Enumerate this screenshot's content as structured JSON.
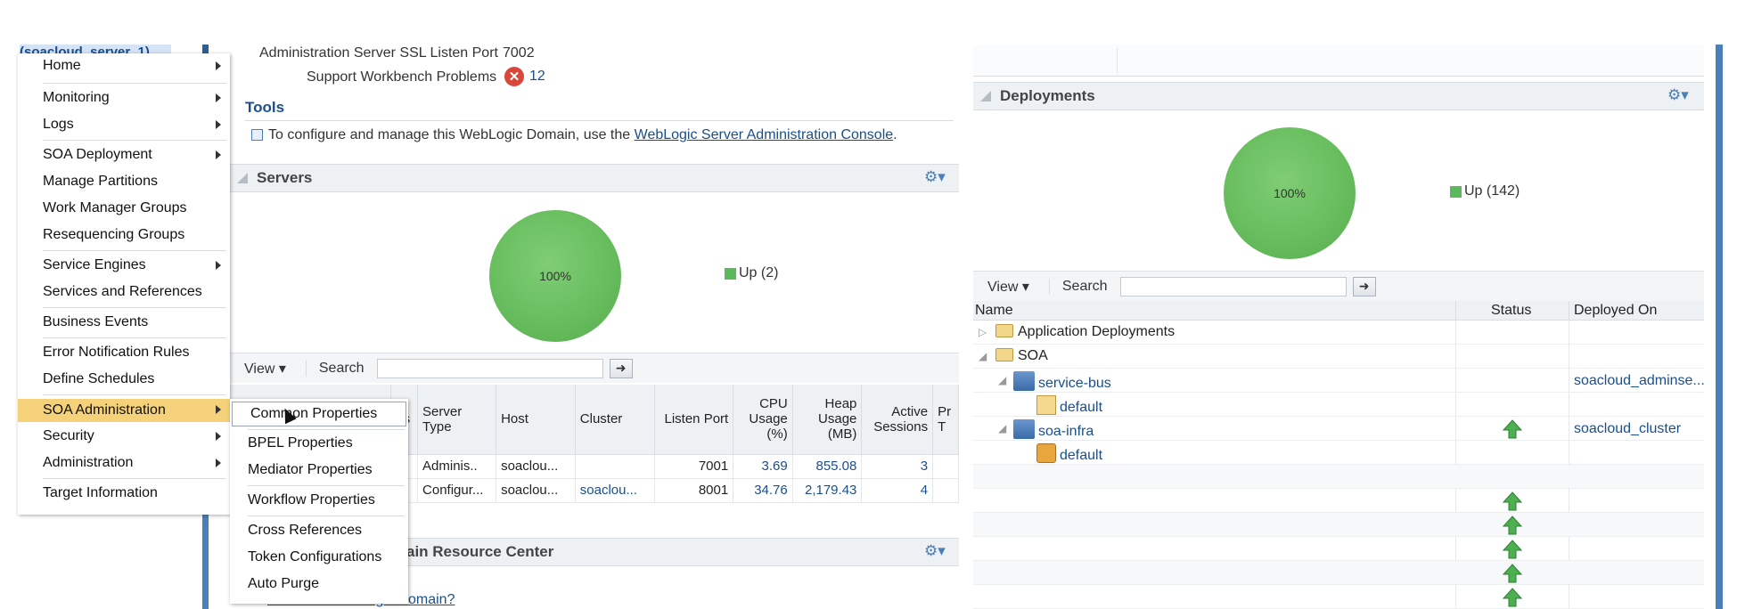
{
  "left_nav": {
    "selected_node": "(soacloud_server_1)"
  },
  "general": {
    "ssl_port_label": "Administration Server SSL Listen Port",
    "ssl_port_value": "7002",
    "workbench_label": "Support Workbench Problems",
    "workbench_count": "12"
  },
  "tools": {
    "title": "Tools",
    "text_before": "To configure and manage this WebLogic Domain, use the",
    "link": "WebLogic Server Administration Console",
    "text_after": "."
  },
  "servers": {
    "title": "Servers",
    "pie_label": "100%",
    "legend": "Up (2)",
    "view_label": "View",
    "search_label": "Search",
    "columns": [
      "us",
      "Server Type",
      "Host",
      "Cluster",
      "Listen Port",
      "CPU Usage (%)",
      "Heap Usage (MB)",
      "Active Sessions",
      "Pr T"
    ],
    "rows": [
      {
        "type": "Adminis..",
        "host": "soaclou...",
        "cluster": "",
        "port": "7001",
        "cpu": "3.69",
        "heap": "855.08",
        "sessions": "3"
      },
      {
        "type": "Configur...",
        "host": "soaclou...",
        "cluster": "soaclou...",
        "port": "8001",
        "cpu": "34.76",
        "heap": "2,179.43",
        "sessions": "4"
      }
    ]
  },
  "resource_center": {
    "title": "ain Resource Center",
    "link": "What is a WebLogic Domain?"
  },
  "context_menu": {
    "items": [
      "Home",
      "Monitoring",
      "Logs",
      "SOA Deployment",
      "Manage Partitions",
      "Work Manager Groups",
      "Resequencing Groups",
      "Service Engines",
      "Services and References",
      "Business Events",
      "Error Notification Rules",
      "Define Schedules",
      "SOA Administration",
      "Security",
      "Administration",
      "Target Information"
    ]
  },
  "submenu": {
    "items": [
      "Common Properties",
      "BPEL Properties",
      "Mediator Properties",
      "Workflow Properties",
      "Cross References",
      "Token Configurations",
      "Auto Purge"
    ]
  },
  "deployments": {
    "title": "Deployments",
    "pie_label": "100%",
    "legend": "Up (142)",
    "view_label": "View",
    "search_label": "Search",
    "columns": [
      "Name",
      "Status",
      "Deployed On"
    ],
    "rows": [
      {
        "name": "Application Deployments",
        "deployed_on": ""
      },
      {
        "name": "SOA",
        "deployed_on": ""
      },
      {
        "name": "service-bus",
        "deployed_on": "soacloud_adminse..."
      },
      {
        "name": "default",
        "deployed_on": ""
      },
      {
        "name": "soa-infra",
        "deployed_on": "soacloud_cluster"
      },
      {
        "name": "default",
        "deployed_on": ""
      }
    ]
  },
  "colors": {
    "accent": "#4a7fb8",
    "menu_highlight": "#f5d27a",
    "status_green": "#5cb85c",
    "link": "#1a4f8b"
  }
}
